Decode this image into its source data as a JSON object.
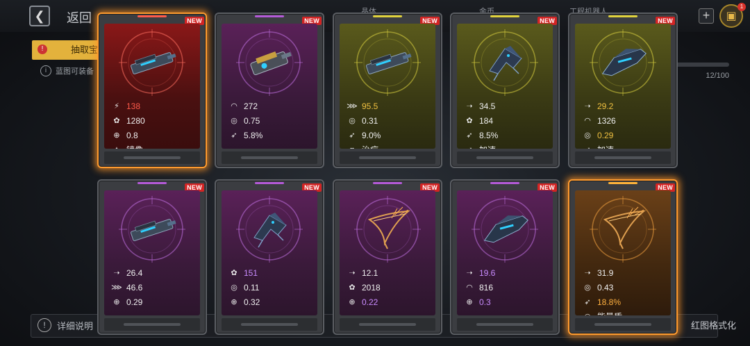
{
  "header": {
    "back_label": "返回",
    "tabs": [
      "晶体",
      "金币",
      "工程机器人"
    ],
    "cart_badge": "1"
  },
  "draw_tab": {
    "label": "抽取宝"
  },
  "info": {
    "text": "蓝图可装备"
  },
  "progress": {
    "text": "12/100"
  },
  "bottom": {
    "detail_label": "详细说明",
    "format_label": "红图格式化"
  },
  "icons": {
    "damage": "damage-icon",
    "energy": "energy-icon",
    "crosshair": "crosshair-icon",
    "mirror": "mirror-icon",
    "armor": "armor-icon",
    "shield": "shield-icon",
    "rocket": "rocket-icon",
    "speed": "speed-icon",
    "heal": "heal-icon",
    "boost": "boost-icon",
    "range": "range-icon"
  },
  "cards": [
    {
      "rarity": "red",
      "new_label": "NEW",
      "selected": true,
      "ship": "cannon",
      "stats": [
        {
          "icon": "damage",
          "value": "138",
          "hl": "red"
        },
        {
          "icon": "energy",
          "value": "1280"
        },
        {
          "icon": "crosshair",
          "value": "0.8"
        },
        {
          "icon": "mirror",
          "value": "镜像"
        }
      ]
    },
    {
      "rarity": "purple",
      "new_label": "NEW",
      "ship": "turret",
      "stats": [
        {
          "icon": "armor",
          "value": "272"
        },
        {
          "icon": "shield",
          "value": "0.75"
        },
        {
          "icon": "rocket",
          "value": "5.8%"
        }
      ]
    },
    {
      "rarity": "yellow",
      "new_label": "NEW",
      "ship": "cannon",
      "stats": [
        {
          "icon": "range",
          "value": "95.5",
          "hl": "yellow"
        },
        {
          "icon": "shield",
          "value": "0.31"
        },
        {
          "icon": "rocket",
          "value": "9.0%"
        },
        {
          "icon": "heal",
          "value": "治疗"
        }
      ]
    },
    {
      "rarity": "yellow",
      "new_label": "NEW",
      "ship": "fighter",
      "stats": [
        {
          "icon": "speed",
          "value": "34.5"
        },
        {
          "icon": "energy",
          "value": "184"
        },
        {
          "icon": "rocket",
          "value": "8.5%"
        },
        {
          "icon": "boost",
          "value": "加速"
        }
      ]
    },
    {
      "rarity": "yellow",
      "new_label": "NEW",
      "ship": "cruiser",
      "stats": [
        {
          "icon": "speed",
          "value": "29.2",
          "hl": "yellow"
        },
        {
          "icon": "armor",
          "value": "1326"
        },
        {
          "icon": "shield",
          "value": "0.29",
          "hl": "yellow"
        },
        {
          "icon": "boost",
          "value": "加速"
        }
      ]
    },
    {
      "rarity": "purple",
      "new_label": "NEW",
      "ship": "cannon",
      "stats": [
        {
          "icon": "speed",
          "value": "26.4"
        },
        {
          "icon": "range",
          "value": "46.6"
        },
        {
          "icon": "crosshair",
          "value": "0.29"
        }
      ]
    },
    {
      "rarity": "purple",
      "new_label": "NEW",
      "ship": "fighter",
      "stats": [
        {
          "icon": "energy",
          "value": "151",
          "hl": "purple"
        },
        {
          "icon": "shield",
          "value": "0.11"
        },
        {
          "icon": "crosshair",
          "value": "0.32"
        }
      ]
    },
    {
      "rarity": "purple",
      "new_label": "NEW",
      "ship": "blade",
      "stats": [
        {
          "icon": "speed",
          "value": "12.1"
        },
        {
          "icon": "energy",
          "value": "2018"
        },
        {
          "icon": "crosshair",
          "value": "0.22",
          "hl": "purple"
        }
      ]
    },
    {
      "rarity": "purple",
      "new_label": "NEW",
      "ship": "cruiser",
      "stats": [
        {
          "icon": "speed",
          "value": "19.6",
          "hl": "purple"
        },
        {
          "icon": "armor",
          "value": "816"
        },
        {
          "icon": "crosshair",
          "value": "0.3",
          "hl": "purple"
        }
      ]
    },
    {
      "rarity": "orange",
      "new_label": "NEW",
      "selected": true,
      "ship": "blade",
      "stats": [
        {
          "icon": "speed",
          "value": "31.9"
        },
        {
          "icon": "shield",
          "value": "0.43"
        },
        {
          "icon": "rocket",
          "value": "18.8%",
          "hl": "orange"
        },
        {
          "icon": "shield",
          "value": "能量盾"
        }
      ]
    }
  ],
  "colors": {
    "red": "#ff5a4a",
    "purple": "#c98cff",
    "yellow": "#f0c040",
    "orange": "#ffb040",
    "select_glow": "#ff9b2f"
  }
}
